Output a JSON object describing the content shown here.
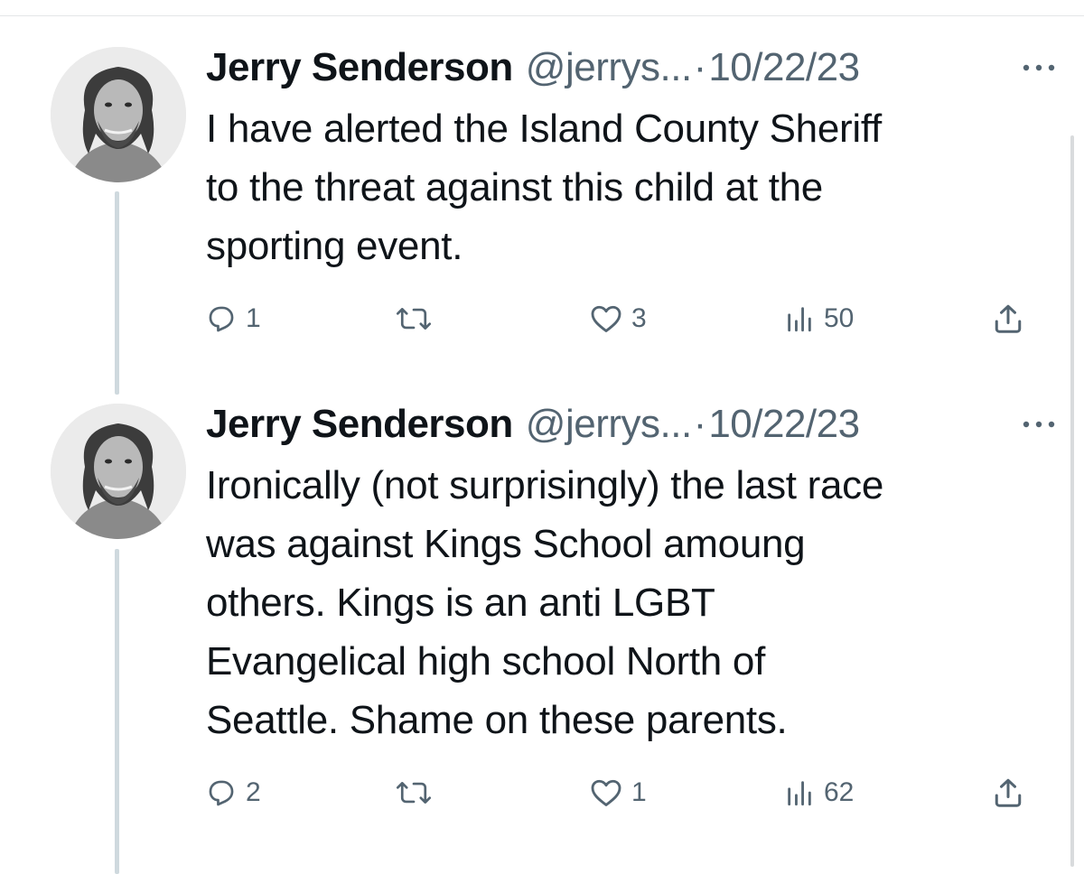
{
  "tweets": [
    {
      "author": {
        "name": "Jerry Senderson",
        "handle": "@jerrys..."
      },
      "separator": "·",
      "date": "10/22/23",
      "more_icon": "more-horizontal-icon",
      "text": "I have alerted the  Island County Sheriff\nto the threat against this child at the\nsporting event.",
      "stats": {
        "replies": "1",
        "retweets": "",
        "likes": "3",
        "views": "50"
      }
    },
    {
      "author": {
        "name": "Jerry Senderson",
        "handle": "@jerrys..."
      },
      "separator": "·",
      "date": "10/22/23",
      "more_icon": "more-horizontal-icon",
      "text": "Ironically (not surprisingly) the last race\nwas against Kings School amoung\nothers.  Kings is an anti LGBT\nEvangelical high school North of\nSeattle.  Shame on these parents.",
      "stats": {
        "replies": "2",
        "retweets": "",
        "likes": "1",
        "views": "62"
      }
    }
  ],
  "icons": {
    "reply": "reply-icon",
    "retweet": "retweet-icon",
    "like": "heart-icon",
    "views": "views-chart-icon",
    "share": "share-icon"
  },
  "colors": {
    "text": "#0f1419",
    "secondary": "#536471",
    "thread_line": "#cfd9de"
  }
}
